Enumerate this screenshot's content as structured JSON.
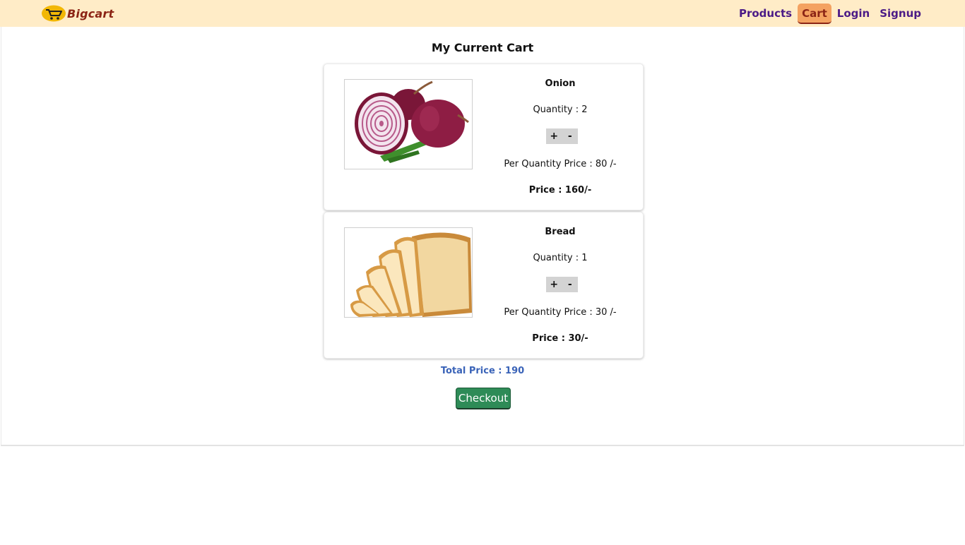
{
  "brand": {
    "name": "Bigcart"
  },
  "nav": {
    "products": "Products",
    "cart": "Cart",
    "login": "Login",
    "signup": "Signup"
  },
  "page": {
    "title": "My Current Cart"
  },
  "items": [
    {
      "name": "Onion",
      "quantity": "Quantity : 2",
      "plus": "+",
      "minus": "-",
      "per_price": "Per Quantity Price : 80 /-",
      "price": "Price : 160/-"
    },
    {
      "name": "Bread",
      "quantity": "Quantity : 1",
      "plus": "+",
      "minus": "-",
      "per_price": "Per Quantity Price : 30 /-",
      "price": "Price : 30/-"
    }
  ],
  "total": "Total Price : 190",
  "checkout": "Checkout",
  "colors": {
    "navbar_bg": "#ffecc7",
    "nav_link": "#4b1a86",
    "nav_active_bg": "#f4a261",
    "brand": "#8b2415",
    "total": "#3a63b8",
    "checkout_bg": "#2e8b57"
  }
}
